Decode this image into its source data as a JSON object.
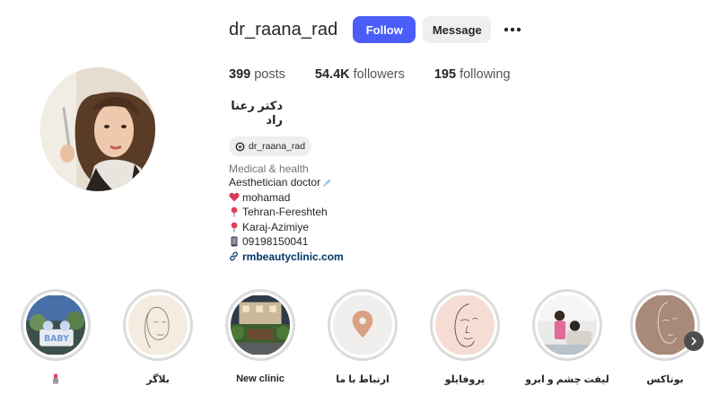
{
  "profile": {
    "username": "dr_raana_rad",
    "follow_label": "Follow",
    "message_label": "Message",
    "more_icon": "more-horizontal-icon"
  },
  "stats": {
    "posts_count": "399",
    "posts_label": "posts",
    "followers_count": "54.4K",
    "followers_label": "followers",
    "following_count": "195",
    "following_label": "following"
  },
  "bio": {
    "full_name": "دکتر رعنا راد",
    "threads_handle": "dr_raana_rad",
    "category": "Medical & health",
    "lines": [
      {
        "text": "Aesthetician doctor",
        "icon": "syringe-icon"
      },
      {
        "text": "mohamad",
        "icon": "heart-icon"
      },
      {
        "text": "Tehran-Fereshteh",
        "icon": "pin-icon"
      },
      {
        "text": "Karaj-Azimiye",
        "icon": "pin-icon"
      },
      {
        "text": "09198150041",
        "icon": "phone-icon"
      }
    ],
    "link": "rmbeautyclinic.com"
  },
  "highlights": [
    {
      "label": "",
      "icon": "lipstick-icon"
    },
    {
      "label": "بلاگر"
    },
    {
      "label": "New clinic"
    },
    {
      "label": "ارتباط با ما"
    },
    {
      "label": "پروفایلو"
    },
    {
      "label": "لیفت چشم و ابرو"
    },
    {
      "label": "بوتاکس"
    }
  ],
  "colors": {
    "accent": "#4a5df9",
    "link": "#00376b",
    "muted": "#737373"
  }
}
